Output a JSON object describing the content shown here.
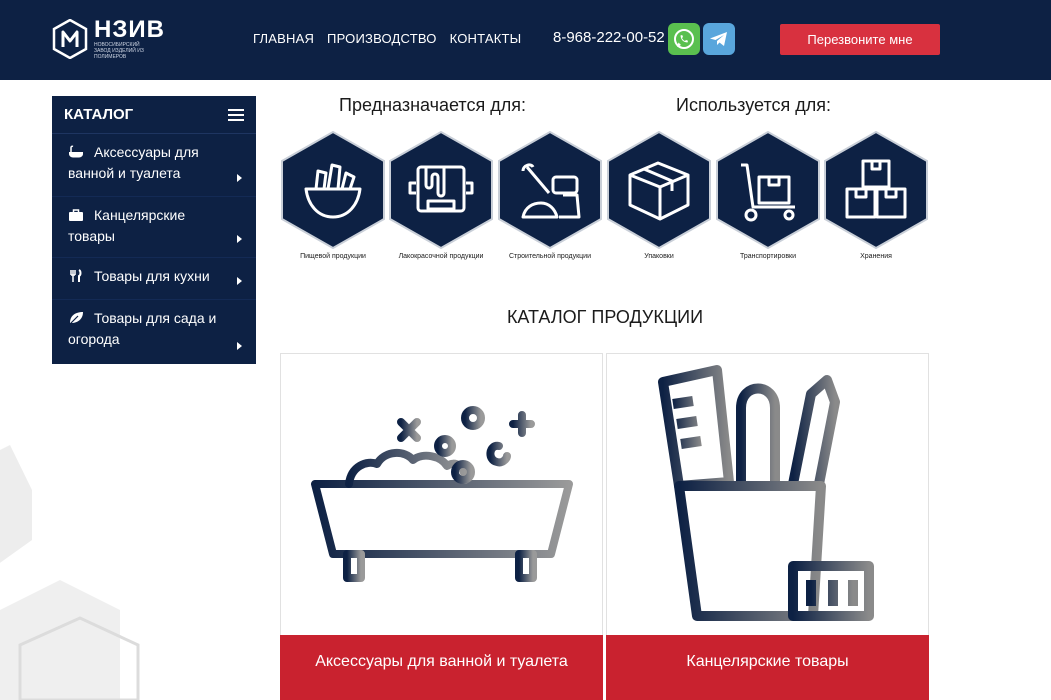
{
  "header": {
    "logo_name": "НЗИВ",
    "logo_subtitle": "новосибирский завод изделий из полимеров",
    "nav": [
      "ГЛАВНАЯ",
      "ПРОИЗВОДСТВО",
      "КОНТАКТЫ"
    ],
    "phone": "8-968-222-00-52",
    "messengers": [
      "whatsapp-icon",
      "telegram-icon"
    ],
    "callback_label": "Перезвоните мне"
  },
  "sidebar": {
    "title": "КАТАЛОГ",
    "items": [
      {
        "label": "Аксессуары для ванной и туалета",
        "icon": "bathtub-icon"
      },
      {
        "label": "Канцелярские товары",
        "icon": "briefcase-icon"
      },
      {
        "label": "Товары для кухни",
        "icon": "cutlery-icon"
      },
      {
        "label": "Товары для сада и огорода",
        "icon": "leaf-icon"
      }
    ]
  },
  "purpose": {
    "intended_title": "Предназначается для:",
    "used_title": "Используется для:"
  },
  "hexagons": [
    {
      "label": "Пищевой продукции",
      "icon": "food-bowl-icon"
    },
    {
      "label": "Лакокрасочной продукции",
      "icon": "paint-bucket-icon"
    },
    {
      "label": "Строительной продукции",
      "icon": "construction-materials-icon"
    },
    {
      "label": "Упаковки",
      "icon": "package-box-icon"
    },
    {
      "label": "Транспортировки",
      "icon": "hand-truck-icon"
    },
    {
      "label": "Хранения",
      "icon": "stacked-boxes-icon"
    }
  ],
  "catalog": {
    "title": "КАТАЛОГ ПРОДУКЦИИ",
    "cards": [
      {
        "label": "Аксессуары для ванной и туалета",
        "icon": "bathtub-icon"
      },
      {
        "label": "Канцелярские товары",
        "icon": "stationery-cup-icon"
      }
    ]
  },
  "colors": {
    "navy": "#0d2144",
    "red": "#c9222f",
    "button_red": "#d8313f",
    "whatsapp": "#5ac04f",
    "telegram": "#59a6dc"
  }
}
